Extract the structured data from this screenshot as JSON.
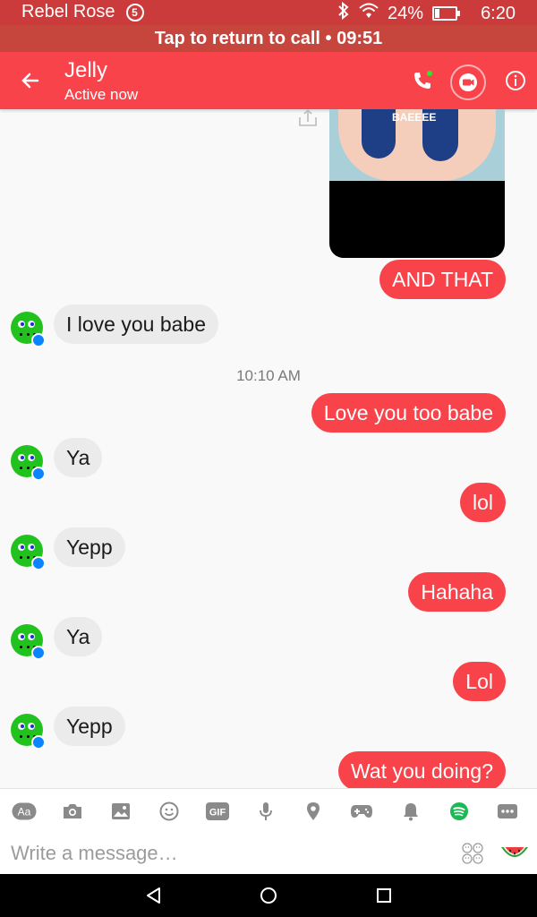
{
  "status_bar": {
    "carrier": "Rebel Rose",
    "notification_count": "5",
    "battery": "24%",
    "battery_level": 0.24,
    "time": "6:20"
  },
  "call_bar": {
    "text": "Tap to return to call • 09:51"
  },
  "header": {
    "name": "Jelly",
    "status": "Active now"
  },
  "colors": {
    "accent": "#f8434b",
    "incoming_bubble": "#ebebeb",
    "spotify": "#1db954",
    "messenger_badge": "#0a84ff"
  },
  "photo_message": {
    "caption": "BAEEEE"
  },
  "messages": [
    {
      "direction": "out",
      "text": "AND THAT"
    },
    {
      "direction": "in",
      "text": "I love you babe"
    },
    {
      "direction": "out",
      "text": "Love you too babe"
    },
    {
      "direction": "in",
      "text": "Ya"
    },
    {
      "direction": "out",
      "text": "lol"
    },
    {
      "direction": "in",
      "text": "Yepp"
    },
    {
      "direction": "out",
      "text": "Hahaha"
    },
    {
      "direction": "in",
      "text": "Ya"
    },
    {
      "direction": "out",
      "text": "Lol"
    },
    {
      "direction": "in",
      "text": "Yepp"
    },
    {
      "direction": "out",
      "text": "Wat you doing?"
    }
  ],
  "timestamp": "10:10 AM",
  "toolbar": {
    "text_label": "Aa",
    "gif_label": "GIF",
    "icons": [
      "text-format-icon",
      "camera-icon",
      "gallery-icon",
      "emoji-icon",
      "gif-icon",
      "microphone-icon",
      "location-icon",
      "game-controller-icon",
      "bell-icon",
      "spotify-icon",
      "more-icon"
    ]
  },
  "composer": {
    "placeholder": "Write a message…"
  }
}
